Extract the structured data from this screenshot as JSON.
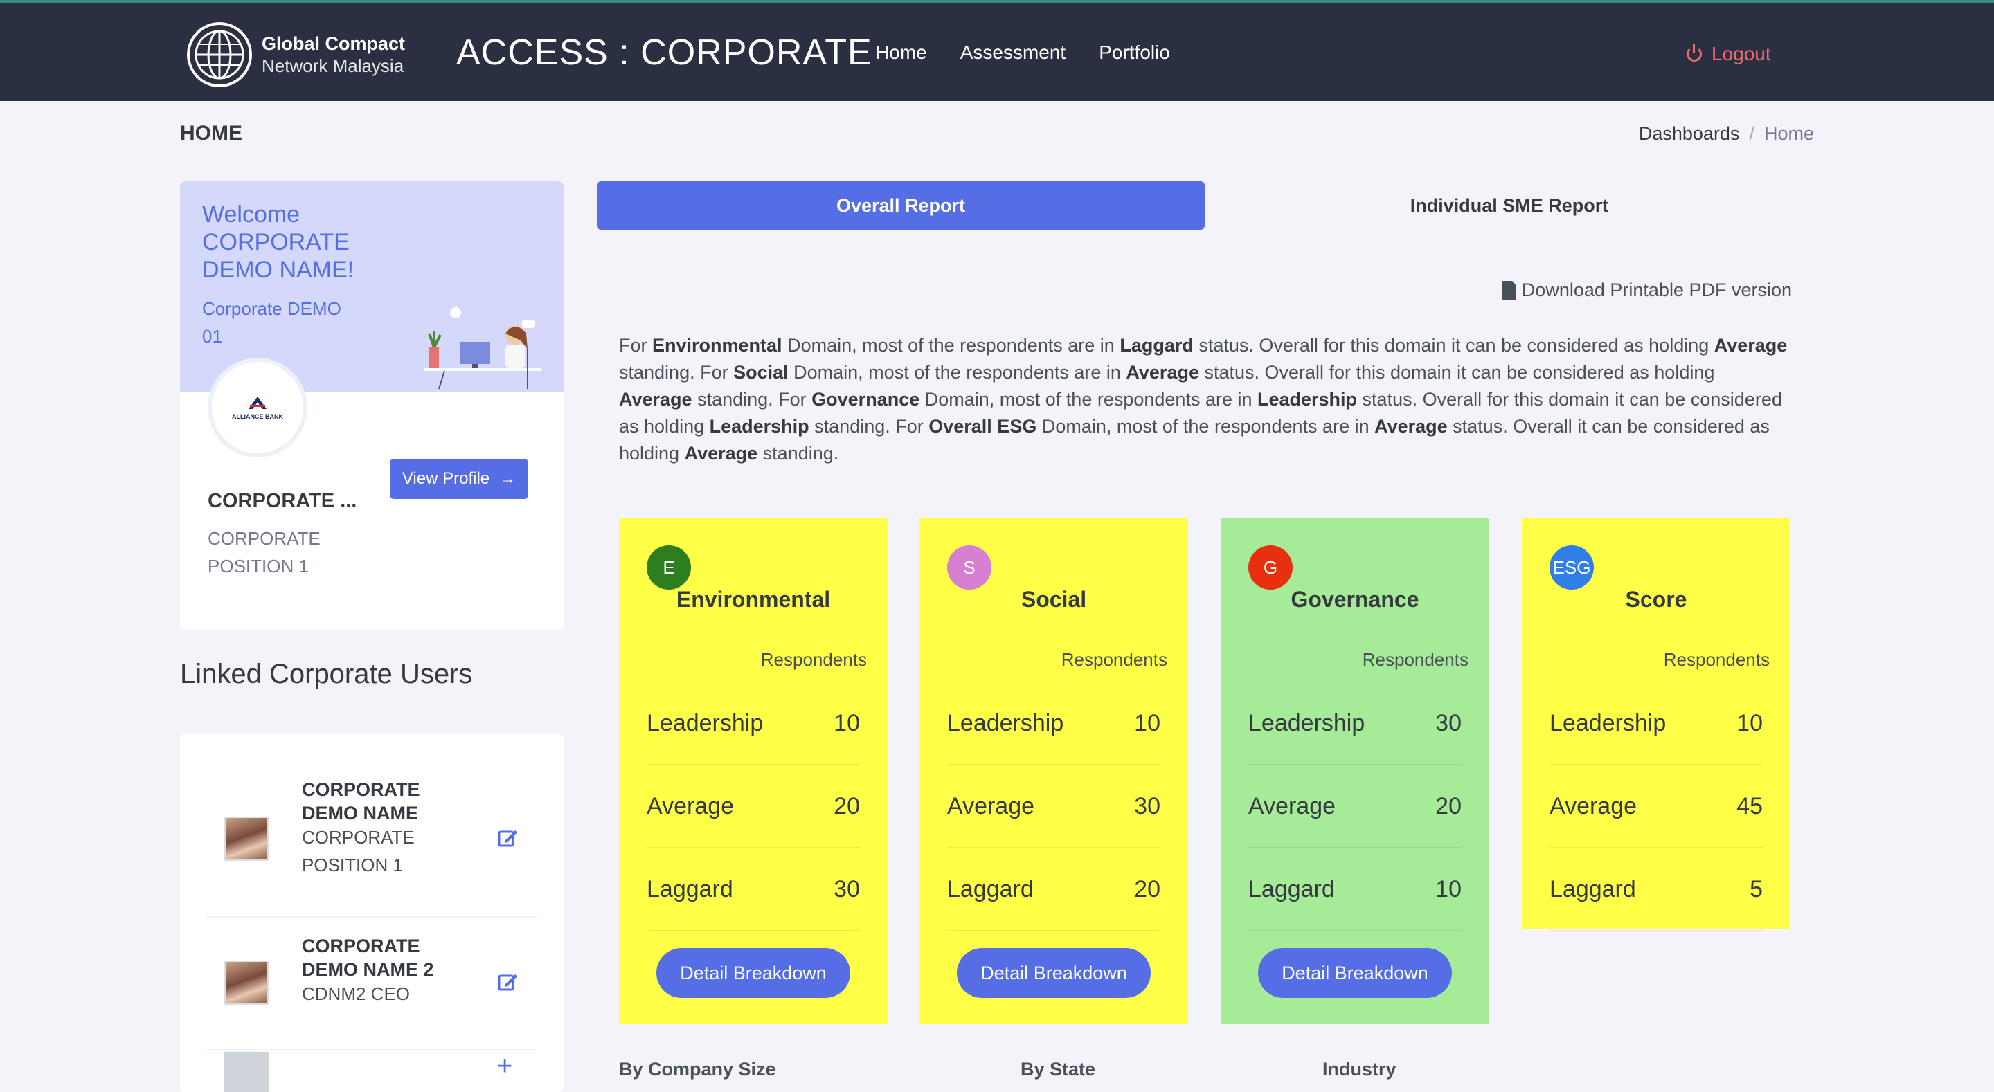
{
  "brand": {
    "line1": "Global Compact",
    "line2": "Network Malaysia",
    "app_title": "ACCESS : CORPORATE"
  },
  "nav": {
    "items": [
      "Home",
      "Assessment",
      "Portfolio"
    ],
    "logout": "Logout"
  },
  "page": {
    "title": "HOME",
    "breadcrumb": [
      "Dashboards",
      "Home"
    ]
  },
  "welcome": {
    "heading": "Welcome CORPORATE DEMO NAME!",
    "org": "Corporate DEMO 01",
    "logo_text": "ALLIANCE BANK",
    "name": "CORPORATE ...",
    "position": "CORPORATE POSITION 1",
    "view_profile": "View Profile"
  },
  "linked": {
    "title": "Linked Corporate Users",
    "users": [
      {
        "name": "CORPORATE DEMO NAME",
        "position": "CORPORATE POSITION 1"
      },
      {
        "name": "CORPORATE DEMO NAME 2",
        "position": "CDNM2 CEO"
      }
    ]
  },
  "tabs": {
    "overall": "Overall Report",
    "individual": "Individual SME Report"
  },
  "download_label": "Download Printable PDF version",
  "summary": [
    {
      "t": "For "
    },
    {
      "b": "Environmental"
    },
    {
      "t": " Domain, most of the respondents are in "
    },
    {
      "b": "Laggard"
    },
    {
      "t": " status. Overall for this domain it can be considered as holding "
    },
    {
      "b": "Average"
    },
    {
      "t": " standing. For "
    },
    {
      "b": "Social"
    },
    {
      "t": " Domain, most of the respondents are in "
    },
    {
      "b": "Average"
    },
    {
      "t": " status. Overall for this domain it can be considered as holding "
    },
    {
      "b": "Average"
    },
    {
      "t": " standing. For "
    },
    {
      "b": "Governance"
    },
    {
      "t": " Domain, most of the respondents are in "
    },
    {
      "b": "Leadership"
    },
    {
      "t": " status. Overall for this domain it can be considered as holding "
    },
    {
      "b": "Leadership"
    },
    {
      "t": " standing. For "
    },
    {
      "b": "Overall ESG"
    },
    {
      "t": " Domain, most of the respondents are in "
    },
    {
      "b": "Average"
    },
    {
      "t": " status. Overall it can be considered as holding "
    },
    {
      "b": "Average"
    },
    {
      "t": " standing."
    }
  ],
  "cards": [
    {
      "badge": "E",
      "badge_color": "#2e7d1f",
      "bg": "#ffff47",
      "title": "Environmental",
      "resp_label": "Respondents",
      "rows": [
        {
          "label": "Leadership",
          "value": "10"
        },
        {
          "label": "Average",
          "value": "20"
        },
        {
          "label": "Laggard",
          "value": "30"
        }
      ],
      "button": "Detail Breakdown"
    },
    {
      "badge": "S",
      "badge_color": "#d67fd3",
      "bg": "#ffff47",
      "title": "Social",
      "resp_label": "Respondents",
      "rows": [
        {
          "label": "Leadership",
          "value": "10"
        },
        {
          "label": "Average",
          "value": "30"
        },
        {
          "label": "Laggard",
          "value": "20"
        }
      ],
      "button": "Detail Breakdown"
    },
    {
      "badge": "G",
      "badge_color": "#e6300f",
      "bg": "#a6eb98",
      "title": "Governance",
      "resp_label": "Respondents",
      "rows": [
        {
          "label": "Leadership",
          "value": "30"
        },
        {
          "label": "Average",
          "value": "20"
        },
        {
          "label": "Laggard",
          "value": "10"
        }
      ],
      "button": "Detail Breakdown"
    },
    {
      "badge": "ESG",
      "badge_color": "#2f7fe6",
      "bg": "#ffff47",
      "title": "Score",
      "resp_label": "Respondents",
      "rows": [
        {
          "label": "Leadership",
          "value": "10"
        },
        {
          "label": "Average",
          "value": "45"
        },
        {
          "label": "Laggard",
          "value": "5"
        }
      ],
      "button": ""
    }
  ],
  "filters": [
    "By Company Size",
    "By State",
    "Industry"
  ]
}
